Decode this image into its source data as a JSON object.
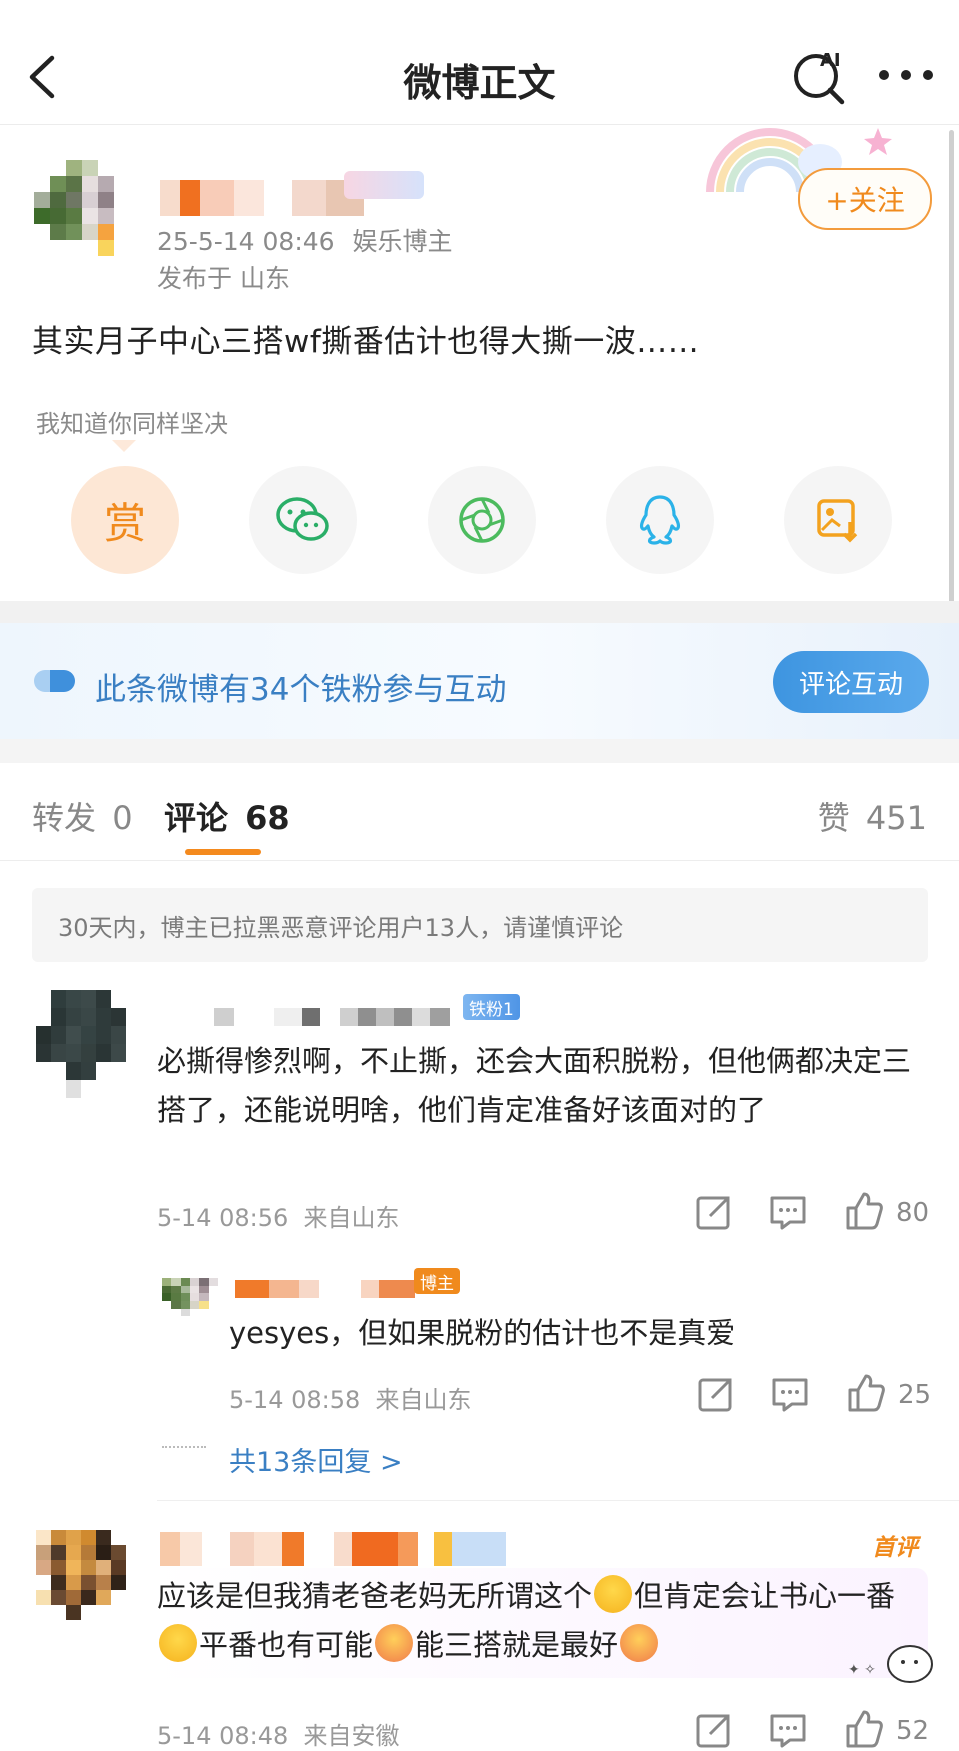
{
  "header": {
    "title": "微博正文"
  },
  "post": {
    "timestamp": "25-5-14 08:46",
    "user_tag": "娱乐博主",
    "location": "发布于 山东",
    "follow_label": "+关注",
    "text": "其实月子中心三搭wf撕番估计也得大撕一波……",
    "reward_hint": "我知道你同样坚决",
    "reward_label": "赏"
  },
  "fan_banner": {
    "text": "此条微博有34个铁粉参与互动",
    "button": "评论互动"
  },
  "tabs": {
    "repost_label": "转发",
    "repost_count": "0",
    "comment_label": "评论",
    "comment_count": "68",
    "like_label": "赞",
    "like_count": "451"
  },
  "notice": "30天内，博主已拉黑恶意评论用户13人，请谨慎评论",
  "comments": [
    {
      "badge": "铁粉1",
      "text": "必撕得惨烈啊，不止撕，还会大面积脱粉，但他俩都决定三搭了，还能说明啥，他们肯定准备好该面对的了",
      "time": "5-14 08:56  来自山东",
      "likes": "80",
      "reply": {
        "badge": "博主",
        "text": "yesyes，但如果脱粉的估计也不是真爱",
        "time": "5-14 08:58  来自山东",
        "likes": "25"
      },
      "more_replies": "共13条回复 >"
    },
    {
      "tag": "首评",
      "text_parts": [
        "应该是但我猜老爸老妈无所谓这个",
        "但肯定会让书心一番",
        "平番也有可能",
        "能三搭就是最好"
      ],
      "time": "5-14 08:48  来自安徽",
      "likes": "52"
    }
  ],
  "colors": {
    "accent": "#f48a1e",
    "link": "#3a7fc3",
    "muted": "#999999"
  }
}
